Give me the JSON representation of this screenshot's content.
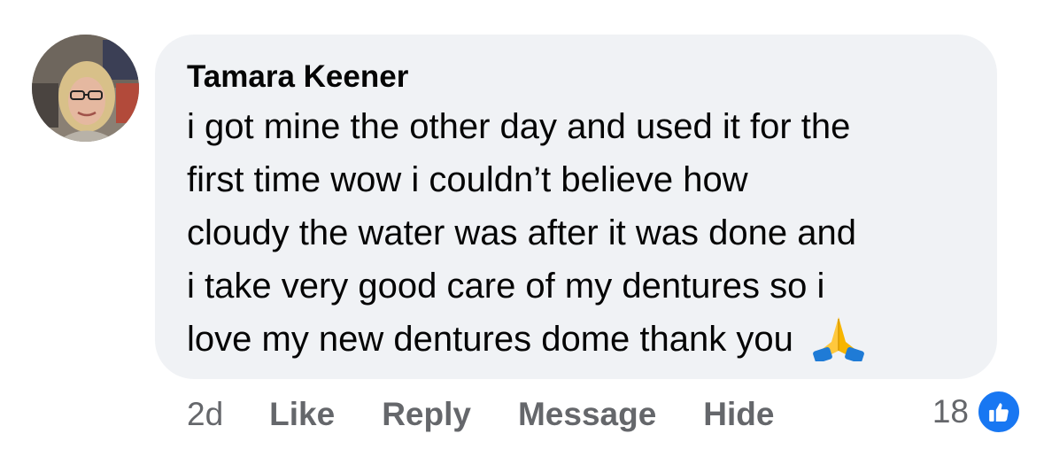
{
  "comment": {
    "author": "Tamara Keener",
    "lines": [
      "i got mine the other day and used it for the",
      "first time wow i couldn’t believe how",
      "cloudy the water was after it was done and",
      "i take very good care of my dentures so i",
      "love my new dentures dome thank you"
    ],
    "emoji": "folded-hands-emoji"
  },
  "actions": {
    "time": "2d",
    "like": "Like",
    "reply": "Reply",
    "message": "Message",
    "hide": "Hide"
  },
  "reactions": {
    "count": "18",
    "icon": "like-thumb-icon",
    "color": "#1877f2"
  }
}
